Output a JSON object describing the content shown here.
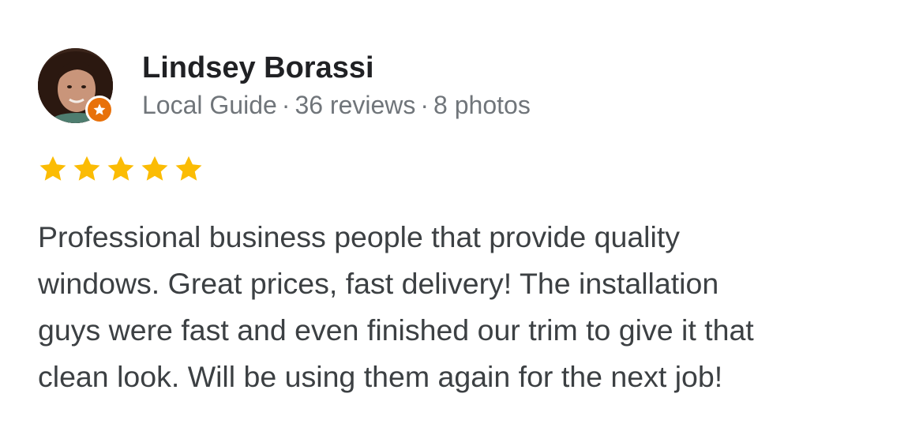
{
  "reviewer": {
    "name": "Lindsey Borassi",
    "status": "Local Guide",
    "reviews": "36 reviews",
    "photos": "8 photos",
    "separator": "·",
    "avatar_icon": "profile-photo",
    "badge_icon": "local-guide-star-badge"
  },
  "rating": {
    "stars": 5,
    "max": 5,
    "star_color": "#fbbc04"
  },
  "review": {
    "text": "Professional business people that provide quality\nwindows. Great prices, fast delivery! The installation\nguys were fast and even finished our trim to give it that\nclean look. Will be using them again for the next job!"
  },
  "colors": {
    "badge": "#e8710a",
    "name": "#202124",
    "meta": "#70757a",
    "body": "#3c4043"
  }
}
